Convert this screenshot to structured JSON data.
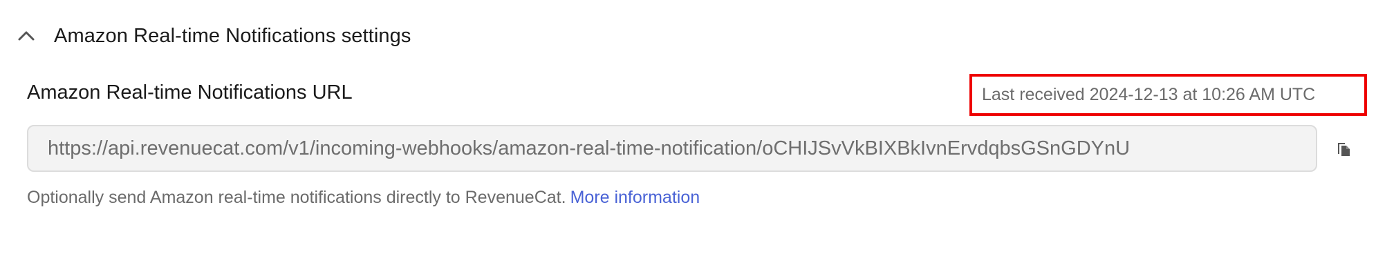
{
  "section": {
    "title": "Amazon Real-time Notifications settings",
    "expanded": true,
    "toggle_icon": "chevron-up-icon"
  },
  "url_field": {
    "label": "Amazon Real-time Notifications URL",
    "value": "https://api.revenuecat.com/v1/incoming-webhooks/amazon-real-time-notification/oCHIJSvVkBIXBkIvnErvdqbsGSnGDYnU",
    "copy_icon": "copy-icon"
  },
  "last_received": {
    "text": "Last received 2024-12-13 at 10:26 AM UTC",
    "highlight_color": "#ee0000"
  },
  "help": {
    "text": "Optionally send Amazon real-time notifications directly to RevenueCat.",
    "link_label": "More information",
    "link_color": "#4a63d6"
  }
}
